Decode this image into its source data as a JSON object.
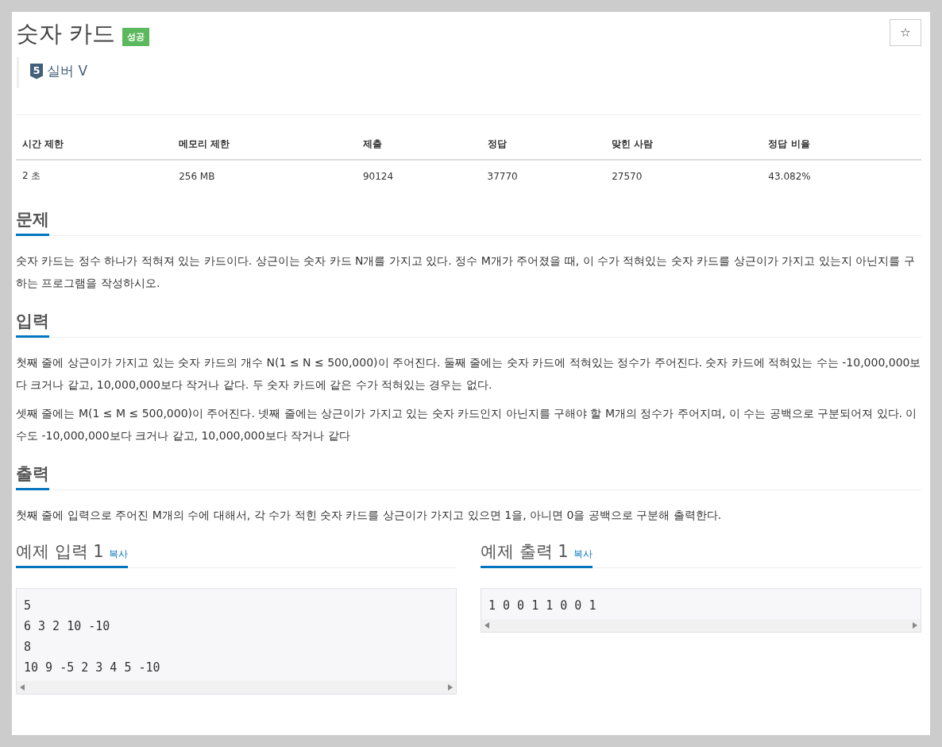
{
  "problem": {
    "title": "숫자 카드",
    "result_badge": "성공",
    "favorite_icon": "☆"
  },
  "tier": {
    "number": "5",
    "name": "실버 V"
  },
  "info_table": {
    "columns": [
      "시간 제한",
      "메모리 제한",
      "제출",
      "정답",
      "맞힌 사람",
      "정답 비율"
    ],
    "rows": [
      [
        "2 초",
        "256 MB",
        "90124",
        "37770",
        "27570",
        "43.082%"
      ]
    ]
  },
  "sections": [
    {
      "heading": "문제",
      "paragraphs": [
        "숫자 카드는 정수 하나가 적혀져 있는 카드이다. 상근이는 숫자 카드 N개를 가지고 있다. 정수 M개가 주어졌을 때, 이 수가 적혀있는 숫자 카드를 상근이가 가지고 있는지 아닌지를 구하는 프로그램을 작성하시오."
      ]
    },
    {
      "heading": "입력",
      "paragraphs": [
        "첫째 줄에 상근이가 가지고 있는 숫자 카드의 개수 N(1 ≤ N ≤ 500,000)이 주어진다. 둘째 줄에는 숫자 카드에 적혀있는 정수가 주어진다. 숫자 카드에 적혀있는 수는 -10,000,000보다 크거나 같고, 10,000,000보다 작거나 같다. 두 숫자 카드에 같은 수가 적혀있는 경우는 없다.",
        "셋째 줄에는 M(1 ≤ M ≤ 500,000)이 주어진다. 넷째 줄에는 상근이가 가지고 있는 숫자 카드인지 아닌지를 구해야 할 M개의 정수가 주어지며, 이 수는 공백으로 구분되어져 있다. 이 수도 -10,000,000보다 크거나 같고, 10,000,000보다 작거나 같다"
      ]
    },
    {
      "heading": "출력",
      "paragraphs": [
        "첫째 줄에 입력으로 주어진 M개의 수에 대해서, 각 수가 적힌 숫자 카드를 상근이가 가지고 있으면 1을, 아니면 0을 공백으로 구분해 출력한다."
      ]
    }
  ],
  "samples": [
    {
      "heading": "예제 입력 1",
      "copy_link": "복사",
      "lines": [
        "5",
        "6 3 2 10 -10",
        "8",
        "10 9 -5 2 3 4 5 -10"
      ]
    },
    {
      "heading": "예제 출력 1",
      "copy_link": "복사",
      "lines": [
        "1 0 0 1 1 0 0 1"
      ]
    }
  ]
}
